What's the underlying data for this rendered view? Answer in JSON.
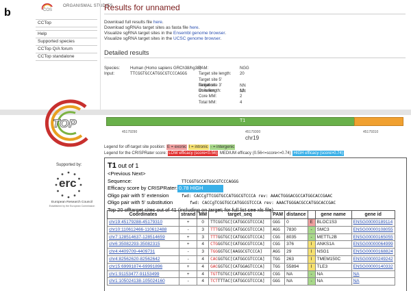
{
  "panel_letter": "b",
  "header": {
    "org_text": "ORGANISMAL STUDIES",
    "title": "Results for unnamed"
  },
  "sidebar": {
    "items": [
      "CCTop",
      "Help",
      "Supported species",
      "CCTop Q/A forum",
      "CCTop standalone"
    ]
  },
  "downloads": [
    {
      "pre": "Download full results file ",
      "link": "here",
      "post": "."
    },
    {
      "pre": "Download sgRNAs target sites as fasta file ",
      "link": "here",
      "post": "."
    },
    {
      "pre": "Visualize sgRNA target sites in the ",
      "link": "Ensembl genome browser",
      "post": "."
    },
    {
      "pre": "Visualize sgRNA target sites in the ",
      "link": "UCSC genome browser",
      "post": "."
    }
  ],
  "detailed": {
    "title": "Detailed results",
    "species_label": "Species:",
    "species_value": "Human (Homo sapiens GRCh38/hg38)",
    "input_label": "Input:",
    "input_value": "TTCGGTGCCATGGCGTCCCAGGG",
    "params": [
      {
        "label": "PAM:",
        "value": "NGG"
      },
      {
        "label": "Target site length:",
        "value": "20"
      },
      {
        "label": "Target site 5' limitation:",
        "value": "NN"
      },
      {
        "label": "Target site 3' limitation:",
        "value": "NN"
      },
      {
        "label": "Core length:",
        "value": "12"
      },
      {
        "label": "Core MM:",
        "value": "2"
      },
      {
        "label": "Total MM:",
        "value": "4"
      }
    ]
  },
  "chrom": {
    "label": "T1",
    "name": "chr19",
    "tick_left": "45179290",
    "tick_mid": "45179300",
    "tick_right": "45179310"
  },
  "legend": {
    "pos_label": "Legend for off-target site position:",
    "exonic": "E = exonic",
    "intronic": "I = intronic",
    "intergenic": "- = intergenic",
    "crispr_label": "Legend for the CRISPRater score:",
    "low": "LOW efficacy (score<0.56)",
    "medium": "MEDIUM efficacy (0.56<=score<=0.74)",
    "high": "HIGH efficacy (score>0.74)",
    "colors": {
      "exonic": "#f0a0a0",
      "intronic": "#f5e070",
      "intergenic": "#a8d88a",
      "low": "#e03030",
      "high": "#3ab0e8"
    }
  },
  "supported_by": "Supported by:",
  "erc": {
    "logo_text": "erc",
    "caption": "European Research Council",
    "sub": "Established by the European Commission"
  },
  "result": {
    "title_bold": "T1",
    "title_rest": " out of 1",
    "nav": "<Previous Next>",
    "sequence_label": "Sequence:",
    "sequence_value": "TTCGGTGCCATGGCGTCCCAGGG",
    "efficacy_label": "Efficacy score by CRISPRater:",
    "efficacy_value": "0.78 HIGH",
    "oligo5_label": "Oligo pair with 5' extension",
    "oligo5_value": "fwd: CACCgTTCGGTGCCATGGCGTCCCA rev: AAACTGGGACGCCATGGCACCGAAC",
    "oligo5s_label": "Oligo pair with 5' substitution",
    "oligo5s_value": "fwd: CACCgTCGGTGCCATGGCGTCCCA rev: AAACTGGGACGCCATGGCACCGAC",
    "top_line": "Top 20 offtarget sites out of 41 (including on target; for full list see xls file)"
  },
  "table": {
    "headers": [
      "Coordinates",
      "strand",
      "MM",
      "target_seq",
      "PAM",
      "distance",
      "",
      "gene name",
      "gene id"
    ],
    "rows": [
      {
        "coord": "chr19:45179288-45179310",
        "strand": "+",
        "mm": "0",
        "red": "",
        "seq": "TTCGGTGC[CATGGCGTCCCA]",
        "pam": "GGG",
        "dist": "0",
        "region": "E",
        "gene": "BLOC1S3",
        "gid": "ENSG00000189114"
      },
      {
        "coord": "chr10:110612466-110612488",
        "strand": "-",
        "mm": "3",
        "red": "T",
        "seq": "TTTGGTGG[CATGGCGTCCCA]",
        "pam": "AGG",
        "dist": "7830",
        "region": "-",
        "gene": "SMC3",
        "gid": "ENSG00000108055"
      },
      {
        "coord": "chr7:128514637-128514659",
        "strand": "+",
        "mm": "3",
        "red": "",
        "seq": "TTTGGTGC[CATGGCGTCCCA]",
        "pam": "CGG",
        "dist": "8035",
        "region": "-",
        "gene": "METTL2B",
        "gid": "ENSG00000165055"
      },
      {
        "coord": "chr6:35082293-35082315",
        "strand": "+",
        "mm": "4",
        "red": "",
        "seq": "CTGGGTGC[CATGGCGTCCCA]",
        "pam": "CGG",
        "dist": "376",
        "region": "I",
        "gene": "ANKS1A",
        "gid": "ENSG00000064999"
      },
      {
        "coord": "chr4:4409709-4409731",
        "strand": "-",
        "mm": "3",
        "red": "",
        "seq": "TGGGGTGC[AAGGCGTCCCA]",
        "pam": "AGG",
        "dist": "29",
        "region": "I",
        "gene": "NSG1",
        "gid": "ENSG00000168824"
      },
      {
        "coord": "chr4:82562620-82562642",
        "strand": "-",
        "mm": "4",
        "red": "",
        "seq": "CACGGTGC[CATGGCGTCCCA]",
        "pam": "TGG",
        "dist": "263",
        "region": "I",
        "gene": "TMEM150C",
        "gid": "ENSG00000249242"
      },
      {
        "coord": "chr15:69991874-69991896",
        "strand": "+",
        "mm": "4",
        "red": "",
        "seq": "GACGGTGC[CATGGAGTCCCA]",
        "pam": "TGG",
        "dist": "55894",
        "region": "I",
        "gene": "TLE3",
        "gid": "ENSG00000140332"
      },
      {
        "coord": "chr1:91153477-91153499",
        "strand": "+",
        "mm": "4",
        "red": "",
        "seq": "TGTTGTGC[CATGGCGTCCCA]",
        "pam": "CGG",
        "dist": "NA",
        "region": "-",
        "gene": "NA",
        "gid": "NA"
      },
      {
        "coord": "chr1:105024138-105024160",
        "strand": "-",
        "mm": "4",
        "red": "",
        "seq": "TCTTTTAC[CATGGCGTCCCA]",
        "pam": "GGG",
        "dist": "NA",
        "region": "-",
        "gene": "NA",
        "gid": "NA"
      }
    ]
  }
}
